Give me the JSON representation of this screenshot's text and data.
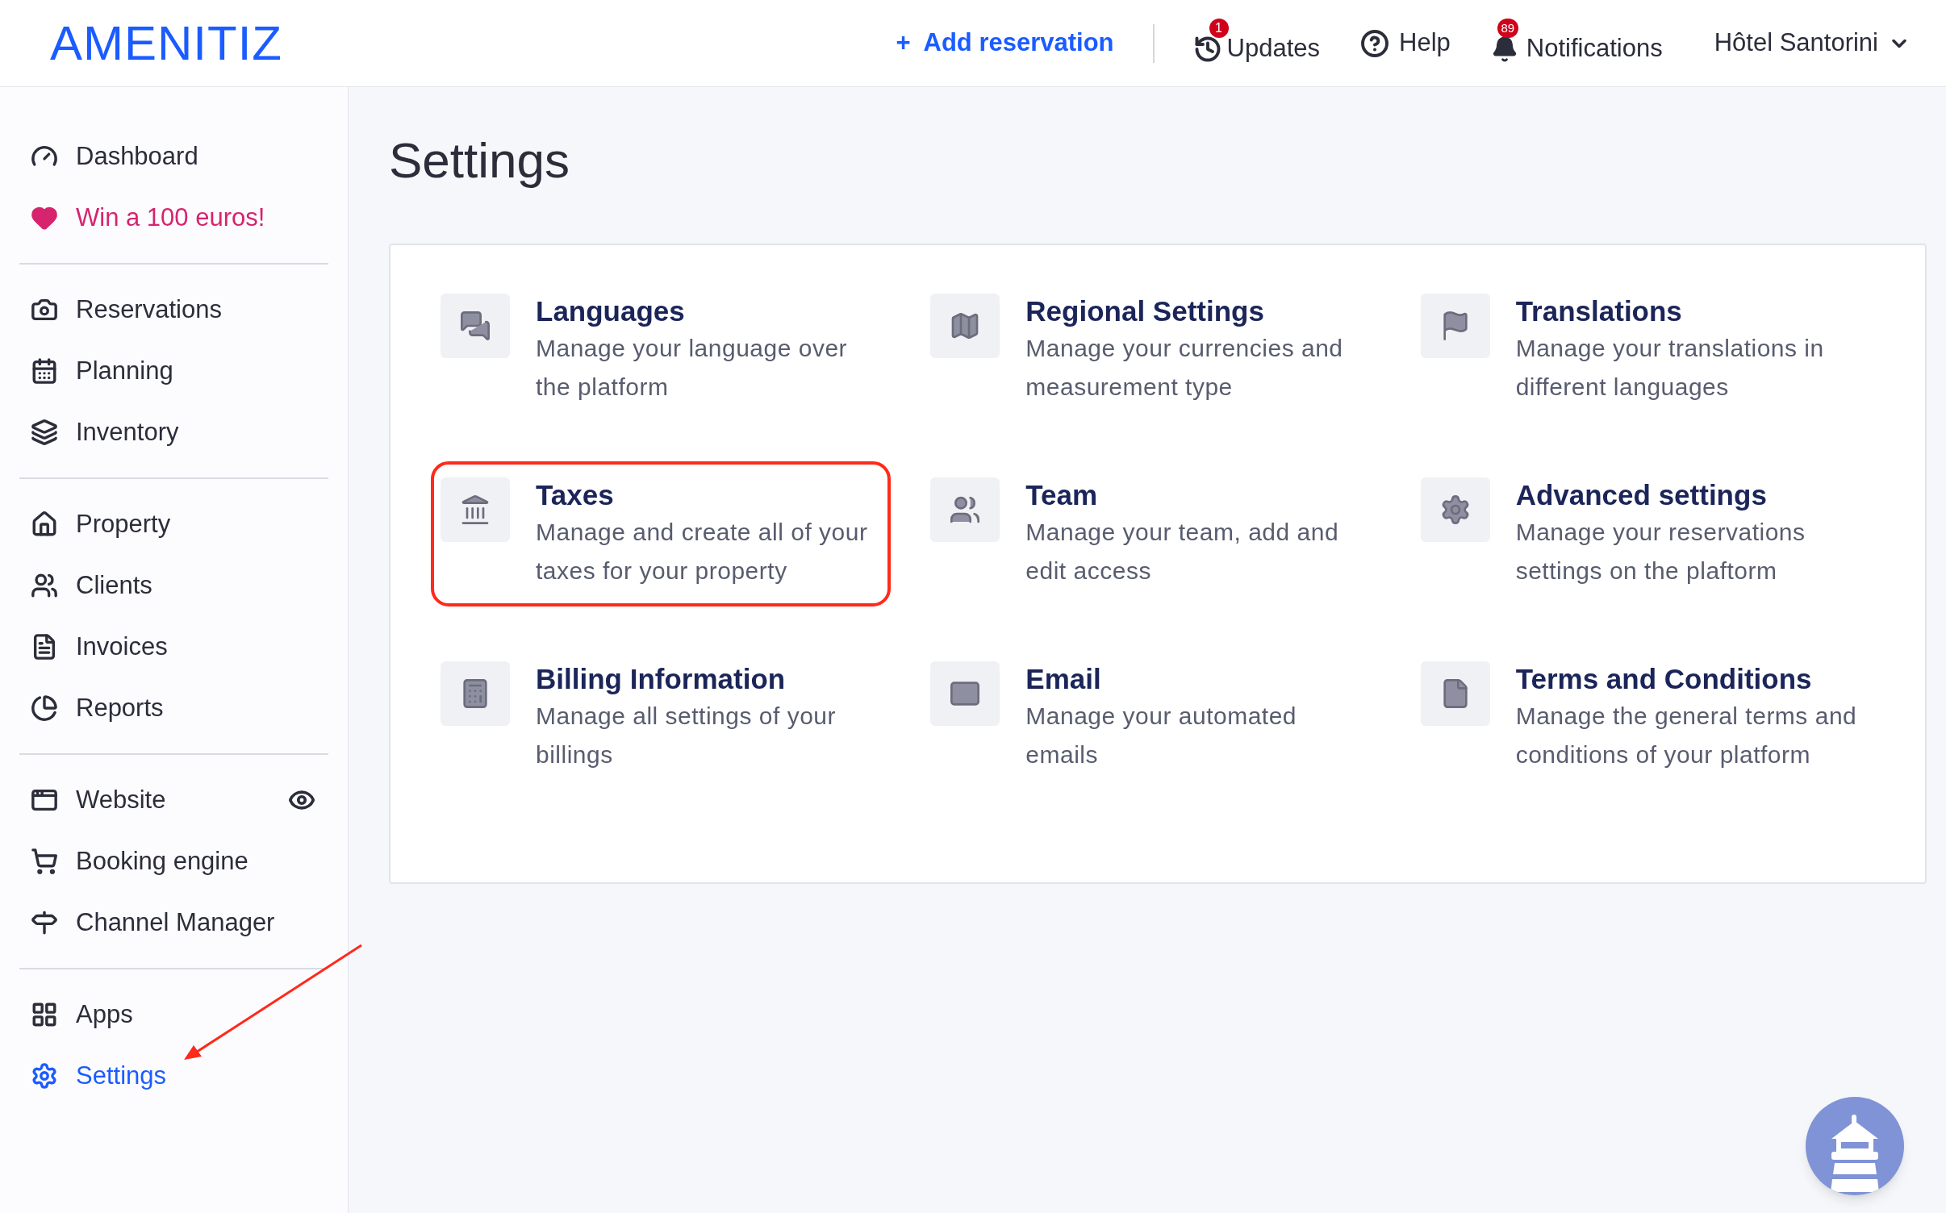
{
  "header": {
    "logo": "AMENITIZ",
    "add_reservation": {
      "icon": "+",
      "label": "Add reservation"
    },
    "updates": {
      "label": "Updates",
      "badge": "1"
    },
    "help": {
      "label": "Help"
    },
    "notifications": {
      "label": "Notifications",
      "badge": "89"
    },
    "hotel": {
      "label": "Hôtel Santorini"
    }
  },
  "sidebar": {
    "groups": [
      [
        {
          "label": "Dashboard",
          "kind": "normal",
          "selected": false
        },
        {
          "label": "Win a 100 euros!",
          "kind": "promo",
          "selected": false
        }
      ],
      [
        {
          "label": "Reservations",
          "kind": "normal",
          "selected": false
        },
        {
          "label": "Planning",
          "kind": "normal",
          "selected": false
        },
        {
          "label": "Inventory",
          "kind": "normal",
          "selected": false
        }
      ],
      [
        {
          "label": "Property",
          "kind": "normal",
          "selected": false
        },
        {
          "label": "Clients",
          "kind": "normal",
          "selected": false
        },
        {
          "label": "Invoices",
          "kind": "normal",
          "selected": false
        },
        {
          "label": "Reports",
          "kind": "normal",
          "selected": false
        }
      ],
      [
        {
          "label": "Website",
          "kind": "preview",
          "selected": false
        },
        {
          "label": "Booking engine",
          "kind": "normal",
          "selected": false
        },
        {
          "label": "Channel Manager",
          "kind": "normal",
          "selected": false
        }
      ],
      [
        {
          "label": "Apps",
          "kind": "normal",
          "selected": false
        },
        {
          "label": "Settings",
          "kind": "normal",
          "selected": true
        }
      ]
    ]
  },
  "page": {
    "title": "Settings",
    "items": [
      {
        "title": "Languages",
        "description": "Manage your language over the platform",
        "highlighted": false
      },
      {
        "title": "Regional Settings",
        "description": "Manage your currencies and measurement type",
        "highlighted": false
      },
      {
        "title": "Translations",
        "description": "Manage your translations in different languages",
        "highlighted": false
      },
      {
        "title": "Taxes",
        "description": "Manage and create all of your taxes for your property",
        "highlighted": true
      },
      {
        "title": "Team",
        "description": "Manage your team, add and edit access",
        "highlighted": false
      },
      {
        "title": "Advanced settings",
        "description": "Manage your reservations settings on the plaftorm",
        "highlighted": false
      },
      {
        "title": "Billing Information",
        "description": "Manage all settings of your billings",
        "highlighted": false
      },
      {
        "title": "Email",
        "description": "Manage your automated emails",
        "highlighted": false
      },
      {
        "title": "Terms and Conditions",
        "description": "Manage the general terms and conditions of your platform",
        "highlighted": false
      }
    ]
  }
}
